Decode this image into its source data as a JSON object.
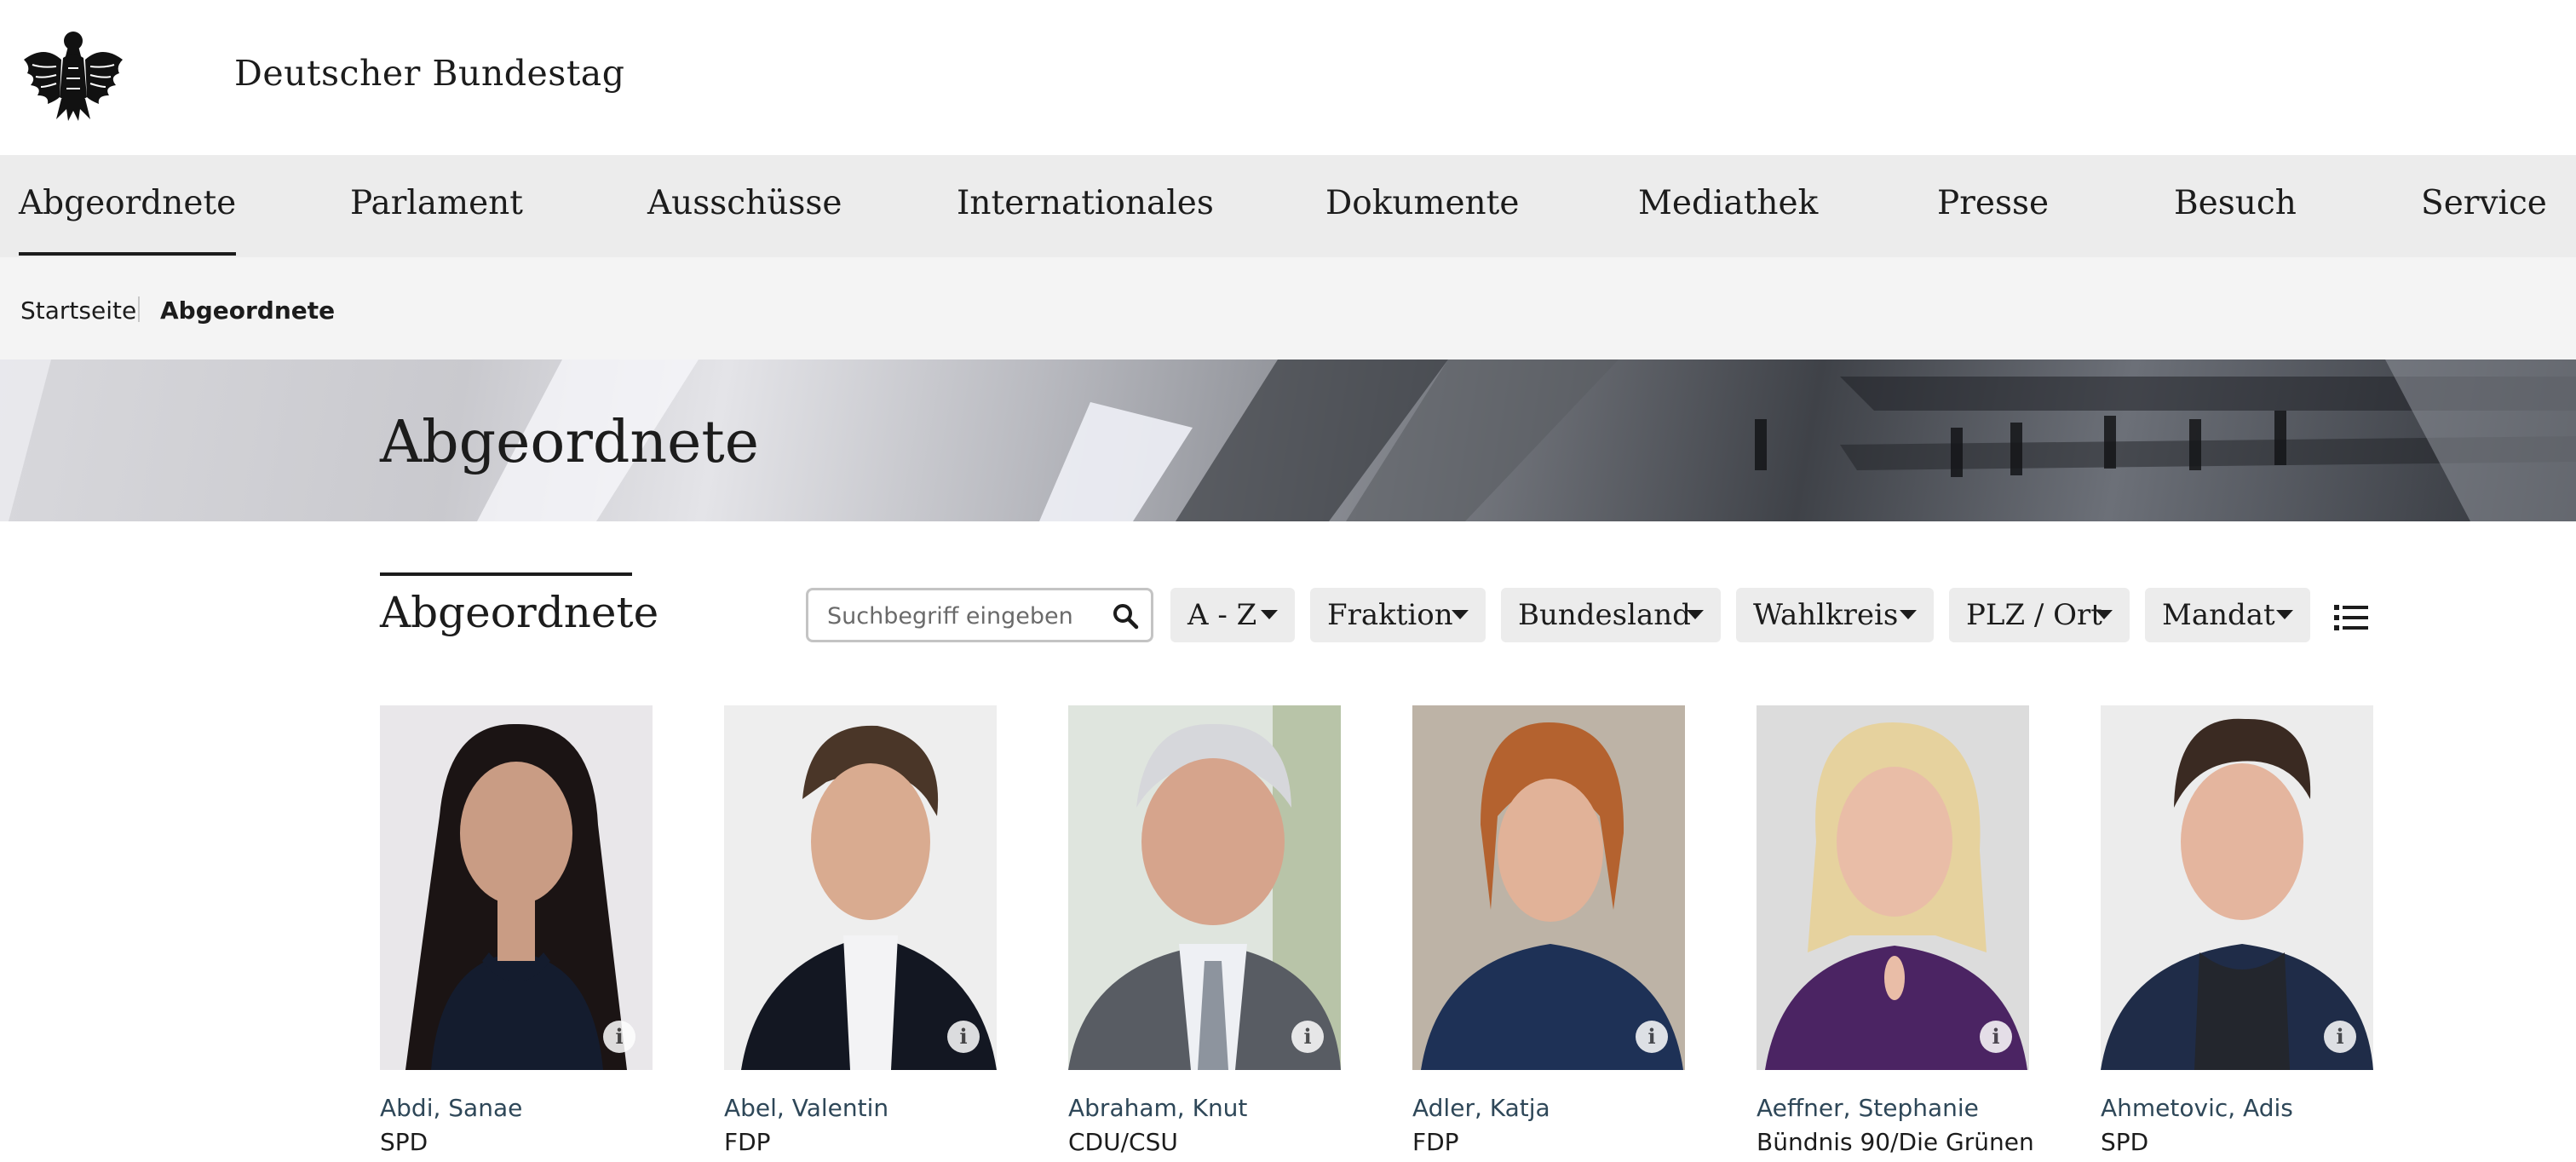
{
  "header": {
    "site_title": "Deutscher Bundestag",
    "logo_icon": "bundesadler-eagle-icon"
  },
  "nav": {
    "items": [
      {
        "label": "Abgeordnete",
        "active": true
      },
      {
        "label": "Parlament",
        "active": false
      },
      {
        "label": "Ausschüsse",
        "active": false
      },
      {
        "label": "Internationales",
        "active": false
      },
      {
        "label": "Dokumente",
        "active": false
      },
      {
        "label": "Mediathek",
        "active": false
      },
      {
        "label": "Presse",
        "active": false
      },
      {
        "label": "Besuch",
        "active": false
      },
      {
        "label": "Service",
        "active": false
      }
    ]
  },
  "breadcrumb": {
    "home": "Startseite",
    "current": "Abgeordnete"
  },
  "hero": {
    "title": "Abgeordnete"
  },
  "section": {
    "title": "Abgeordnete"
  },
  "search": {
    "placeholder": "Suchbegriff eingeben",
    "value": "",
    "icon": "search-icon"
  },
  "filters": [
    {
      "label": "A - Z"
    },
    {
      "label": "Fraktion"
    },
    {
      "label": "Bundesland"
    },
    {
      "label": "Wahlkreis"
    },
    {
      "label": "PLZ / Ort"
    },
    {
      "label": "Mandat"
    }
  ],
  "view_toggle_icon": "list-view-icon",
  "members": [
    {
      "name": "Abdi, Sanae",
      "party": "SPD"
    },
    {
      "name": "Abel, Valentin",
      "party": "FDP"
    },
    {
      "name": "Abraham, Knut",
      "party": "CDU/CSU"
    },
    {
      "name": "Adler, Katja",
      "party": "FDP"
    },
    {
      "name": "Aeffner, Stephanie",
      "party": "Bündnis 90/Die Grünen"
    },
    {
      "name": "Ahmetovic, Adis",
      "party": "SPD"
    }
  ],
  "colors": {
    "nav_bg": "#ececec",
    "breadcrumb_bg": "#f4f4f4",
    "name_link": "#2e4758",
    "text": "#1c1c1c"
  }
}
